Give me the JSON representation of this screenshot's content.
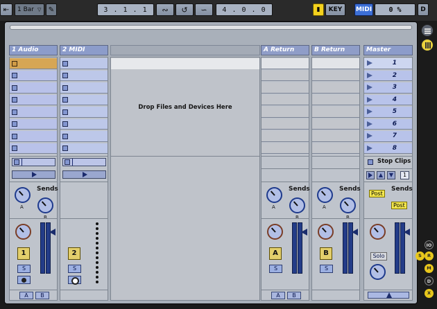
{
  "topbar": {
    "quantize": "1 Bar",
    "arrangement_position": "3 .   1 .   1",
    "loop_length": "4 .   0 .   0",
    "key_label": "KEY",
    "midi_label": "MIDI",
    "cpu": "0 %",
    "d_label": "D"
  },
  "tracks": [
    {
      "name": "1 Audio",
      "number": "1"
    },
    {
      "name": "2 MIDI",
      "number": "2"
    }
  ],
  "returns": [
    {
      "name": "A Return",
      "number": "A"
    },
    {
      "name": "B Return",
      "number": "B"
    }
  ],
  "master": {
    "name": "Master"
  },
  "drop_hint": "Drop Files and Devices Here",
  "scenes": [
    "1",
    "2",
    "3",
    "4",
    "5",
    "6",
    "7",
    "8"
  ],
  "stop_clips": "Stop Clips",
  "sends_label": "Sends",
  "post_label": "Post",
  "solo_label": "Solo",
  "send_a": "A",
  "send_b": "B",
  "s_label": "S",
  "scene_count": "1",
  "side": {
    "io": "IO",
    "s": "S",
    "r": "R",
    "m": "M",
    "d": "D",
    "x": "X"
  }
}
